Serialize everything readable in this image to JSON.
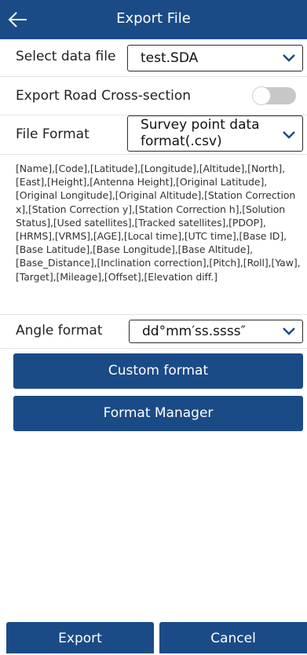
{
  "header": {
    "title": "Export File"
  },
  "data_file": {
    "label": "Select data file",
    "value": "test.SDA"
  },
  "road_section": {
    "label": "Export Road Cross-section",
    "enabled": false
  },
  "file_format": {
    "label": "File Format",
    "value_line1": "Survey point data",
    "value_line2": "format(.csv)"
  },
  "fields_text": "[Name],[Code],[Latitude],[Longitude],[Altitude],[North],[East],[Height],[Antenna Height],[Original Latitude],[Original Longitude],[Original Altitude],[Station Correction x],[Station Correction y],[Station Correction h],[Solution Status],[Used satellites],[Tracked satellites],[PDOP],[HRMS],[VRMS],[AGE],[Local time],[UTC time],[Base ID],[Base Latitude],[Base Longitude],[Base Altitude],[Base_Distance],[Inclination correction],[Pitch],[Roll],[Yaw],[Target],[Mileage],[Offset],[Elevation diff.]",
  "angle_format": {
    "label": "Angle format",
    "value": "dd°mm′ss.ssss″"
  },
  "buttons": {
    "custom_format": "Custom format",
    "format_manager": "Format Manager",
    "export": "Export",
    "cancel": "Cancel"
  },
  "colors": {
    "primary": "#1b4b86",
    "chevron": "#1b4b86",
    "toggle_off": "#c8c8c8"
  }
}
